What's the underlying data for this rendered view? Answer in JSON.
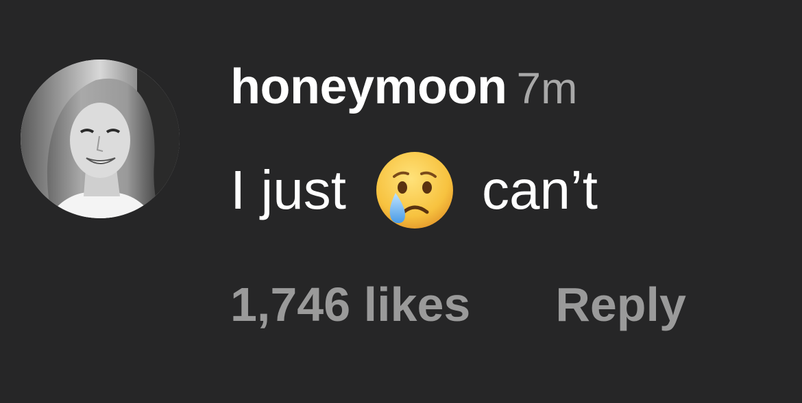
{
  "comment": {
    "username": "honeymoon",
    "timestamp": "7m",
    "text_before": "I just",
    "emoji": "crying-face",
    "text_after": "can’t",
    "likes": "1,746 likes",
    "reply_label": "Reply"
  },
  "colors": {
    "background": "#262627",
    "primary_text": "#ffffff",
    "secondary_text": "#9a9a9a"
  }
}
